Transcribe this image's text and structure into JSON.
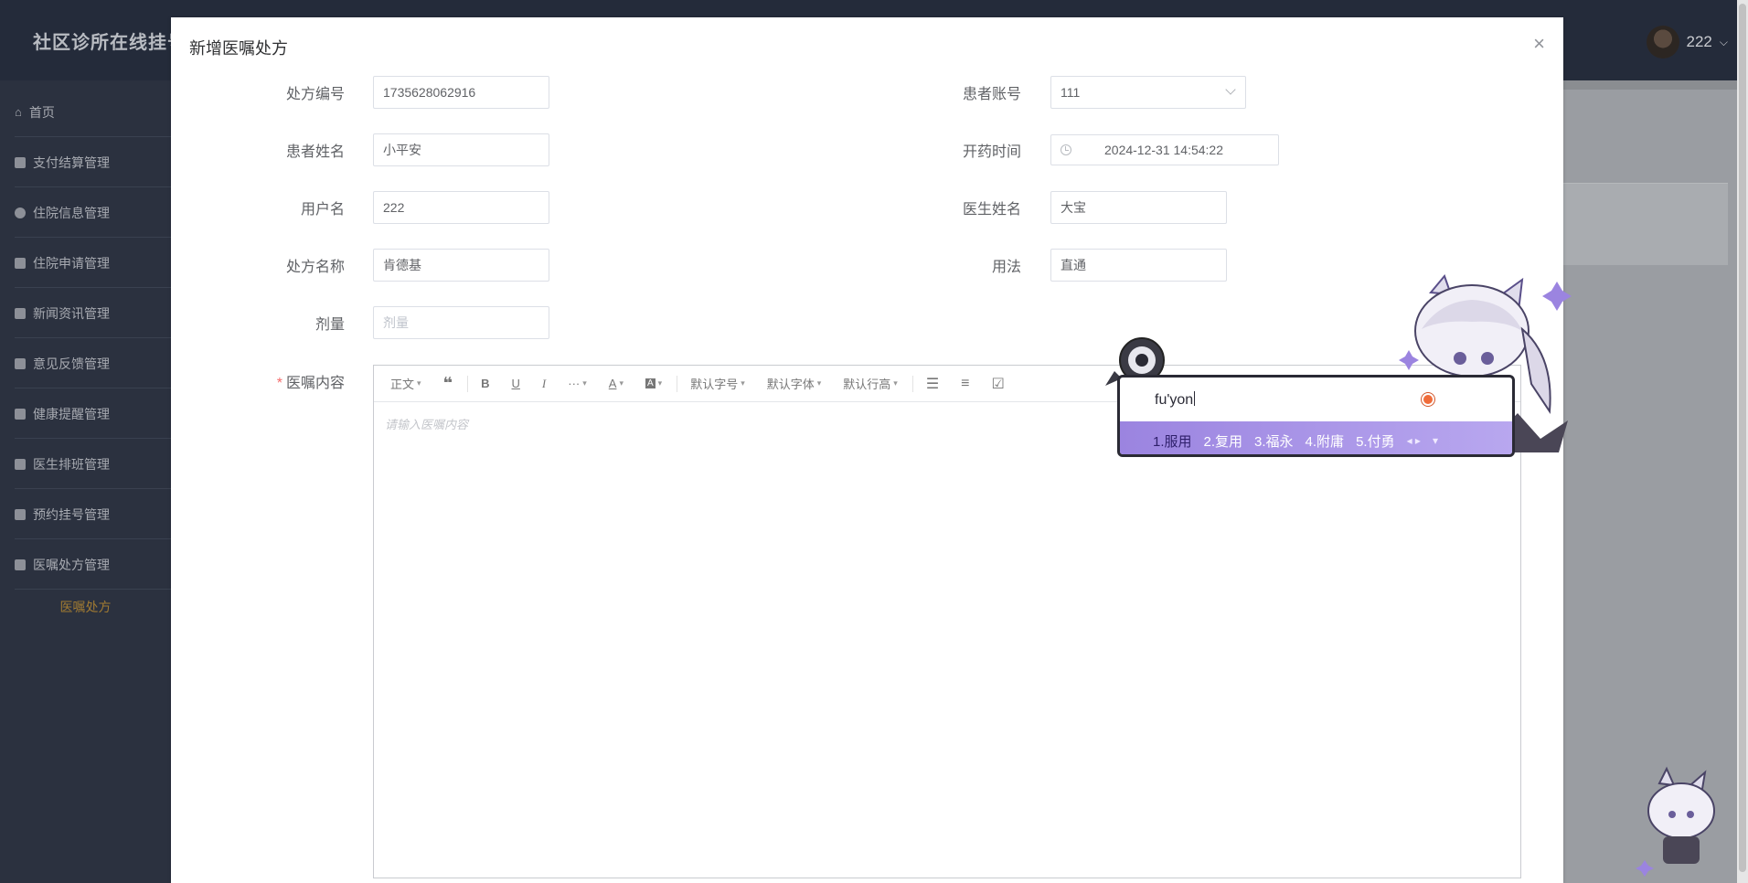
{
  "app": {
    "title": "社区诊所在线挂号",
    "username": "222"
  },
  "sidebar": {
    "items": [
      {
        "label": "首页"
      },
      {
        "label": "支付结算管理"
      },
      {
        "label": "住院信息管理"
      },
      {
        "label": "住院申请管理"
      },
      {
        "label": "新闻资讯管理"
      },
      {
        "label": "意见反馈管理"
      },
      {
        "label": "健康提醒管理"
      },
      {
        "label": "医生排班管理"
      },
      {
        "label": "预约挂号管理"
      },
      {
        "label": "医嘱处方管理"
      }
    ],
    "active_sub": "医嘱处方"
  },
  "dialog": {
    "title": "新增医嘱处方",
    "close_glyph": "×",
    "form": {
      "rx_no": {
        "label": "处方编号",
        "value": "1735628062916"
      },
      "patient_name": {
        "label": "患者姓名",
        "value": "小平安"
      },
      "username": {
        "label": "用户名",
        "value": "222"
      },
      "rx_name": {
        "label": "处方名称",
        "value": "肯德基"
      },
      "dosage": {
        "label": "剂量",
        "value": "",
        "placeholder": "剂量"
      },
      "patient_account": {
        "label": "患者账号",
        "value": "111"
      },
      "rx_time": {
        "label": "开药时间",
        "value": "2024-12-31 14:54:22"
      },
      "doctor_name": {
        "label": "医生姓名",
        "value": "大宝"
      },
      "usage": {
        "label": "用法",
        "value": "直通"
      },
      "advice": {
        "label": "医嘱内容",
        "placeholder": "请输入医嘱内容"
      }
    },
    "toolbar": {
      "paragraph": "正文",
      "quote_icon": "quote-icon",
      "bold": "B",
      "underline": "U",
      "italic": "I",
      "more": "···",
      "font_color": "A",
      "bg_color": "A",
      "font_size": "默认字号",
      "font_family": "默认字体",
      "line_height": "默认行高"
    }
  },
  "ime": {
    "input": "fu'yon",
    "candidates": [
      "1.服用",
      "2.复用",
      "3.福永",
      "4.附庸",
      "5.付勇"
    ]
  },
  "colors": {
    "header_bg": "#242b3a",
    "sidebar_bg": "#2b313f",
    "active_sub": "#a07a32",
    "ime_bar": "#9b84e0",
    "required_star": "#f56c6c"
  }
}
